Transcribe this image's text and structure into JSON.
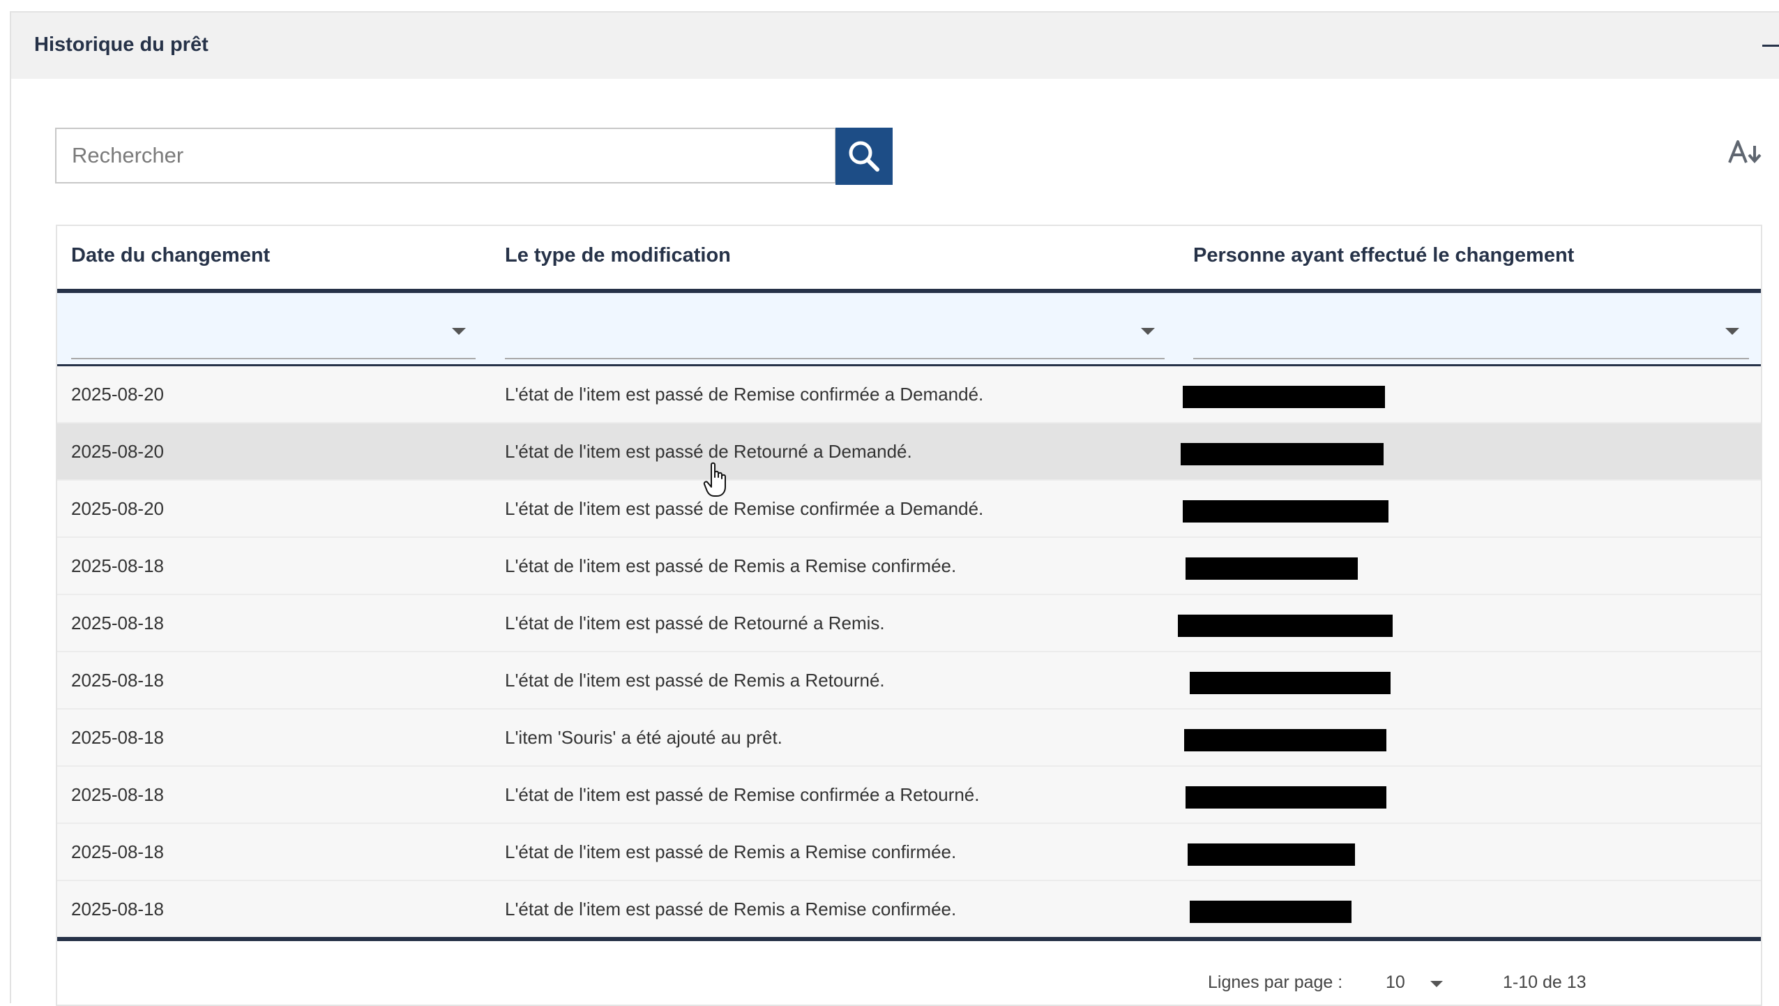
{
  "panel": {
    "title": "Historique du prêt"
  },
  "search": {
    "placeholder": "Rechercher",
    "value": ""
  },
  "icons": {
    "search": "search-icon",
    "sort": "sort-alpha-icon",
    "collapse": "minus-icon",
    "dropdown": "chevron-down-icon",
    "cursor": "hand-pointer-icon"
  },
  "colors": {
    "accent": "#1d4d86",
    "header_dark": "#263248",
    "filter_bg": "#f0f7ff",
    "row_bg": "#f7f7f7",
    "row_hover": "#e3e3e3"
  },
  "table": {
    "columns": [
      "Date du changement",
      "Le type de modification",
      "Personne ayant effectué le changement"
    ],
    "rows": [
      {
        "date": "2025-08-20",
        "type": "L'état de l'item est passé de Remise confirmée a Demandé.",
        "person": ""
      },
      {
        "date": "2025-08-20",
        "type": "L'état de l'item est passé de Retourné a Demandé.",
        "person": ""
      },
      {
        "date": "2025-08-20",
        "type": "L'état de l'item est passé de Remise confirmée a Demandé.",
        "person": ""
      },
      {
        "date": "2025-08-18",
        "type": "L'état de l'item est passé de Remis a Remise confirmée.",
        "person": ""
      },
      {
        "date": "2025-08-18",
        "type": "L'état de l'item est passé de Retourné a Remis.",
        "person": ""
      },
      {
        "date": "2025-08-18",
        "type": "L'état de l'item est passé de Remis a Retourné.",
        "person": ""
      },
      {
        "date": "2025-08-18",
        "type": "L'item 'Souris' a été ajouté au prêt.",
        "person": ""
      },
      {
        "date": "2025-08-18",
        "type": "L'état de l'item est passé de Remise confirmée a Retourné.",
        "person": ""
      },
      {
        "date": "2025-08-18",
        "type": "L'état de l'item est passé de Remis a Remise confirmée.",
        "person": ""
      },
      {
        "date": "2025-08-18",
        "type": "L'état de l'item est passé de Remis a Remise confirmée.",
        "person": ""
      }
    ]
  },
  "pagination": {
    "rows_per_page_label": "Lignes par page :",
    "rows_per_page_value": "10",
    "range": "1-10 de 13"
  }
}
